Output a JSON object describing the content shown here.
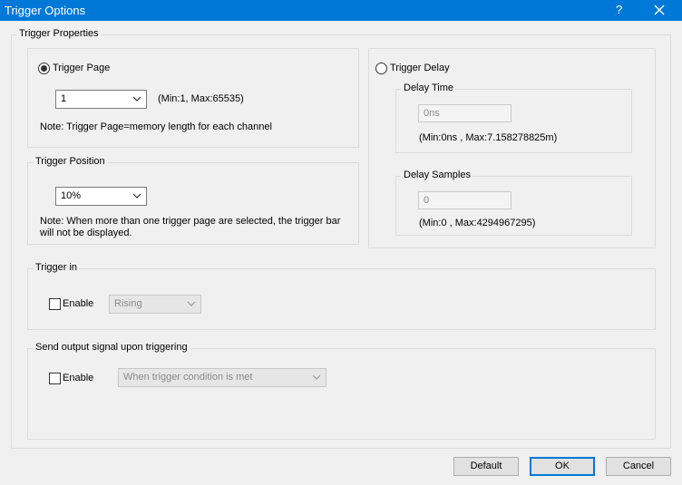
{
  "window": {
    "title": "Trigger Options",
    "help_label": "?",
    "close_icon": "close-icon"
  },
  "trigger_properties": {
    "label": "Trigger Properties",
    "trigger_page": {
      "radio_label": "Trigger Page",
      "selected": true,
      "value": "1",
      "range_text": "(Min:1, Max:65535)",
      "note": "Note: Trigger Page=memory length for each channel"
    },
    "trigger_position": {
      "label": "Trigger Position",
      "value": "10%",
      "note_line1": "Note: When more than one trigger page are selected, the trigger bar",
      "note_line2": "will not be displayed."
    },
    "trigger_delay": {
      "radio_label": "Trigger Delay",
      "selected": false,
      "delay_time": {
        "label": "Delay Time",
        "value": "0ns",
        "range_text": "(Min:0ns , Max:7.158278825m)"
      },
      "delay_samples": {
        "label": "Delay Samples",
        "value": "0",
        "range_text": "(Min:0 , Max:4294967295)"
      }
    },
    "trigger_in": {
      "label": "Trigger in",
      "enable_label": "Enable",
      "enabled": false,
      "edge_value": "Rising"
    },
    "send_output": {
      "label": "Send output signal upon triggering",
      "enable_label": "Enable",
      "enabled": false,
      "condition_value": "When trigger condition is met"
    }
  },
  "buttons": {
    "default": "Default",
    "ok": "OK",
    "cancel": "Cancel"
  }
}
